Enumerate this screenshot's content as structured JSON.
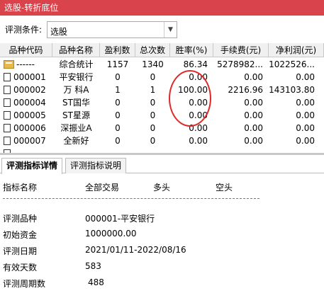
{
  "window": {
    "title": "选股-转折底位"
  },
  "criteria": {
    "label": "评测条件:",
    "selected": "选股"
  },
  "table": {
    "headers": [
      "品种代码",
      "品种名称",
      "盈利数",
      "总次数",
      "胜率(%)",
      "手续费(元)",
      "净利润(元)"
    ],
    "rows": [
      {
        "code": "------",
        "name": "综合统计",
        "wins": "1157",
        "total": "1340",
        "winrate": "86.34",
        "fee": "5278982...",
        "profit": "1022526..."
      },
      {
        "code": "000001",
        "name": "平安银行",
        "wins": "0",
        "total": "0",
        "winrate": "0.00",
        "fee": "0.00",
        "profit": "0.00"
      },
      {
        "code": "000002",
        "name": "万 科A",
        "wins": "1",
        "total": "1",
        "winrate": "100.00",
        "fee": "2216.96",
        "profit": "143103.80"
      },
      {
        "code": "000004",
        "name": "ST国华",
        "wins": "0",
        "total": "0",
        "winrate": "0.00",
        "fee": "0.00",
        "profit": "0.00"
      },
      {
        "code": "000005",
        "name": "ST星源",
        "wins": "0",
        "total": "0",
        "winrate": "0.00",
        "fee": "0.00",
        "profit": "0.00"
      },
      {
        "code": "000006",
        "name": "深振业A",
        "wins": "0",
        "total": "0",
        "winrate": "0.00",
        "fee": "0.00",
        "profit": "0.00"
      },
      {
        "code": "000007",
        "name": "全新好",
        "wins": "0",
        "total": "0",
        "winrate": "0.00",
        "fee": "0.00",
        "profit": "0.00"
      }
    ]
  },
  "tabs": [
    {
      "label": "评测指标详情",
      "active": true
    },
    {
      "label": "评测指标说明",
      "active": false
    }
  ],
  "detail": {
    "headers": [
      "指标名称",
      "全部交易",
      "多头",
      "空头"
    ],
    "items": [
      {
        "label": "评测品种",
        "value": "000001-平安银行"
      },
      {
        "label": "初始资金",
        "value": "1000000.00"
      },
      {
        "label": "评测日期",
        "value": "2021/01/11-2022/08/16"
      },
      {
        "label": "有效天数",
        "value": "583"
      },
      {
        "label": "评测周期数",
        "value": "488"
      }
    ]
  },
  "colors": {
    "titlebar": "#d9434b",
    "highlight": "#e02828"
  }
}
